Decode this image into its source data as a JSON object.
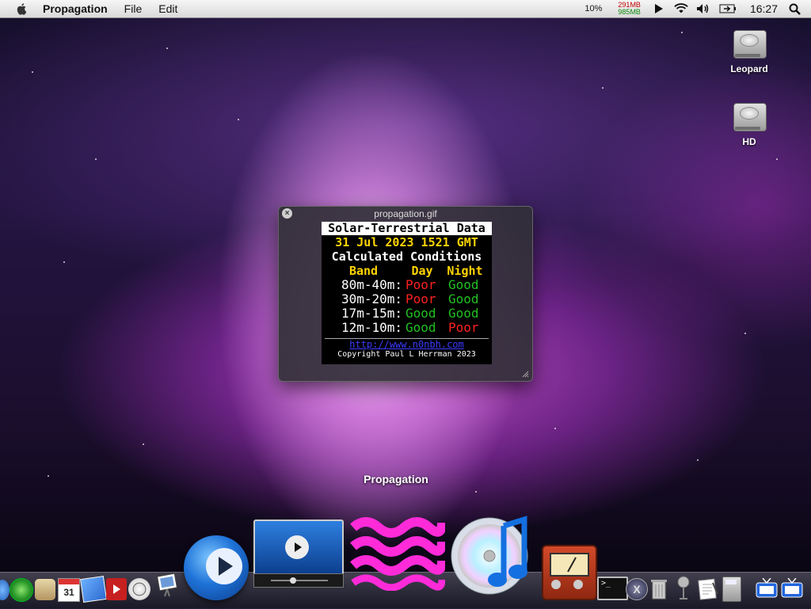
{
  "menubar": {
    "app_name": "Propagation",
    "menus": [
      "File",
      "Edit"
    ],
    "cpu": "10%",
    "mem_used": "291MB",
    "mem_free": "985MB",
    "clock": "16:27"
  },
  "desktop": {
    "icons": [
      {
        "label": "Leopard",
        "icon": "hard-drive-icon"
      },
      {
        "label": "HD",
        "icon": "hard-drive-icon"
      }
    ]
  },
  "quicklook": {
    "title": "propagation.gif",
    "gif": {
      "title": "Solar-Terrestrial Data",
      "date": "31 Jul 2023 1521 GMT",
      "subtitle": "Calculated Conditions",
      "headers": [
        "Band",
        "Day",
        "Night"
      ],
      "rows": [
        {
          "band": "80m-40m:",
          "day": "Poor",
          "night": "Good"
        },
        {
          "band": "30m-20m:",
          "day": "Poor",
          "night": "Good"
        },
        {
          "band": "17m-15m:",
          "day": "Good",
          "night": "Good"
        },
        {
          "band": "12m-10m:",
          "day": "Good",
          "night": "Poor"
        }
      ],
      "url": "http://www.n0nbh.com",
      "copyright": "Copyright Paul L Herrman 2023"
    }
  },
  "dock": {
    "hover_label": "Propagation",
    "items": [
      "finder",
      "safari",
      "address-book",
      "ical",
      "iphoto",
      "dvd-player",
      "front-row",
      "preview",
      "quicktime",
      "video-player",
      "propagation",
      "itunes",
      "audio-meter",
      "terminal",
      "x11",
      "trash-can",
      "podcast",
      "textedit",
      "calculator",
      "tv",
      "tv"
    ]
  },
  "colors": {
    "good": "#22c022",
    "poor": "#ff2020",
    "date": "#ffd400"
  }
}
